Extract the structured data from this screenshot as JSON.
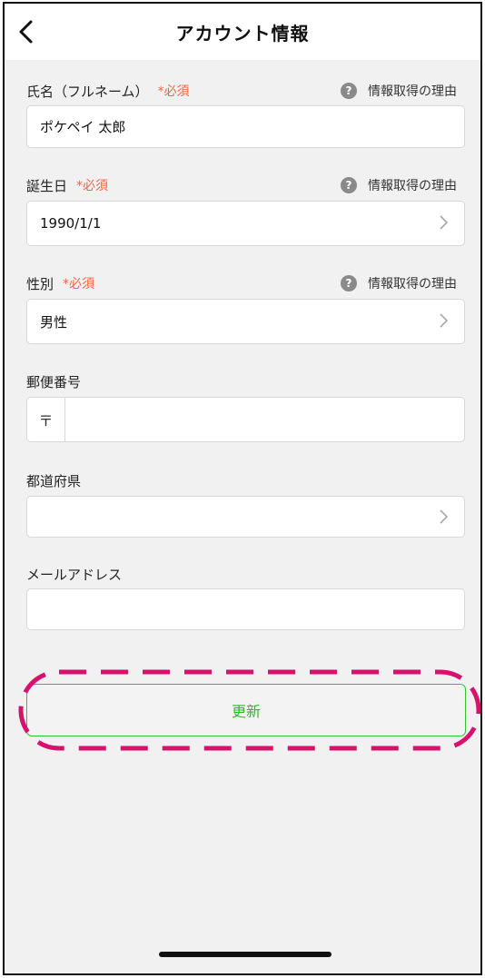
{
  "header": {
    "title": "アカウント情報"
  },
  "form": {
    "required_mark": "*必須",
    "reason_text": "情報取得の理由",
    "full_name": {
      "label": "氏名（フルネーム）",
      "value": "ポケペイ 太郎"
    },
    "birthday": {
      "label": "誕生日",
      "value": "1990/1/1"
    },
    "gender": {
      "label": "性別",
      "value": "男性"
    },
    "postal_code": {
      "label": "郵便番号",
      "prefix": "〒",
      "value": ""
    },
    "prefecture": {
      "label": "都道府県",
      "value": ""
    },
    "email": {
      "label": "メールアドレス",
      "value": ""
    }
  },
  "actions": {
    "update_label": "更新"
  },
  "colors": {
    "required": "#f0634a",
    "accent": "#35c12d",
    "highlight": "#d5136d"
  }
}
